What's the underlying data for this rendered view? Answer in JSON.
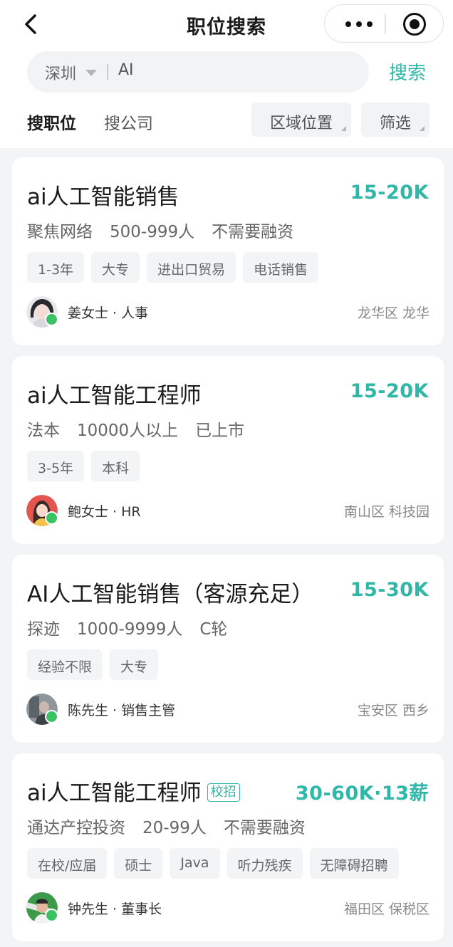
{
  "nav": {
    "title": "职位搜索"
  },
  "search": {
    "city": "深圳",
    "keyword": "AI",
    "button": "搜索"
  },
  "tabs": {
    "job": "搜职位",
    "company": "搜公司"
  },
  "filters": {
    "area": "区域位置",
    "screen": "筛选"
  },
  "colors": {
    "accent": "#2fb7a8",
    "online": "#3ac264"
  },
  "jobs": [
    {
      "title": "ai人工智能销售",
      "salary": "15-20K",
      "badge": "",
      "company": "聚焦网络",
      "size": "500-999人",
      "stage": "不需要融资",
      "tags": [
        "1-3年",
        "大专",
        "进出口贸易",
        "电话销售"
      ],
      "recruiter": "姜女士 · 人事",
      "location": "龙华区 龙华"
    },
    {
      "title": "ai人工智能工程师",
      "salary": "15-20K",
      "badge": "",
      "company": "法本",
      "size": "10000人以上",
      "stage": "已上市",
      "tags": [
        "3-5年",
        "本科"
      ],
      "recruiter": "鲍女士 · HR",
      "location": "南山区 科技园"
    },
    {
      "title": "AI人工智能销售（客源充足）",
      "salary": "15-30K",
      "badge": "",
      "company": "探迹",
      "size": "1000-9999人",
      "stage": "C轮",
      "tags": [
        "经验不限",
        "大专"
      ],
      "recruiter": "陈先生 · 销售主管",
      "location": "宝安区 西乡"
    },
    {
      "title": "ai人工智能工程师",
      "salary": "30-60K·13薪",
      "badge": "校招",
      "company": "通达产控投资",
      "size": "20-99人",
      "stage": "不需要融资",
      "tags": [
        "在校/应届",
        "硕士",
        "Java",
        "听力残疾",
        "无障碍招聘"
      ],
      "recruiter": "钟先生 · 董事长",
      "location": "福田区 保税区"
    }
  ]
}
